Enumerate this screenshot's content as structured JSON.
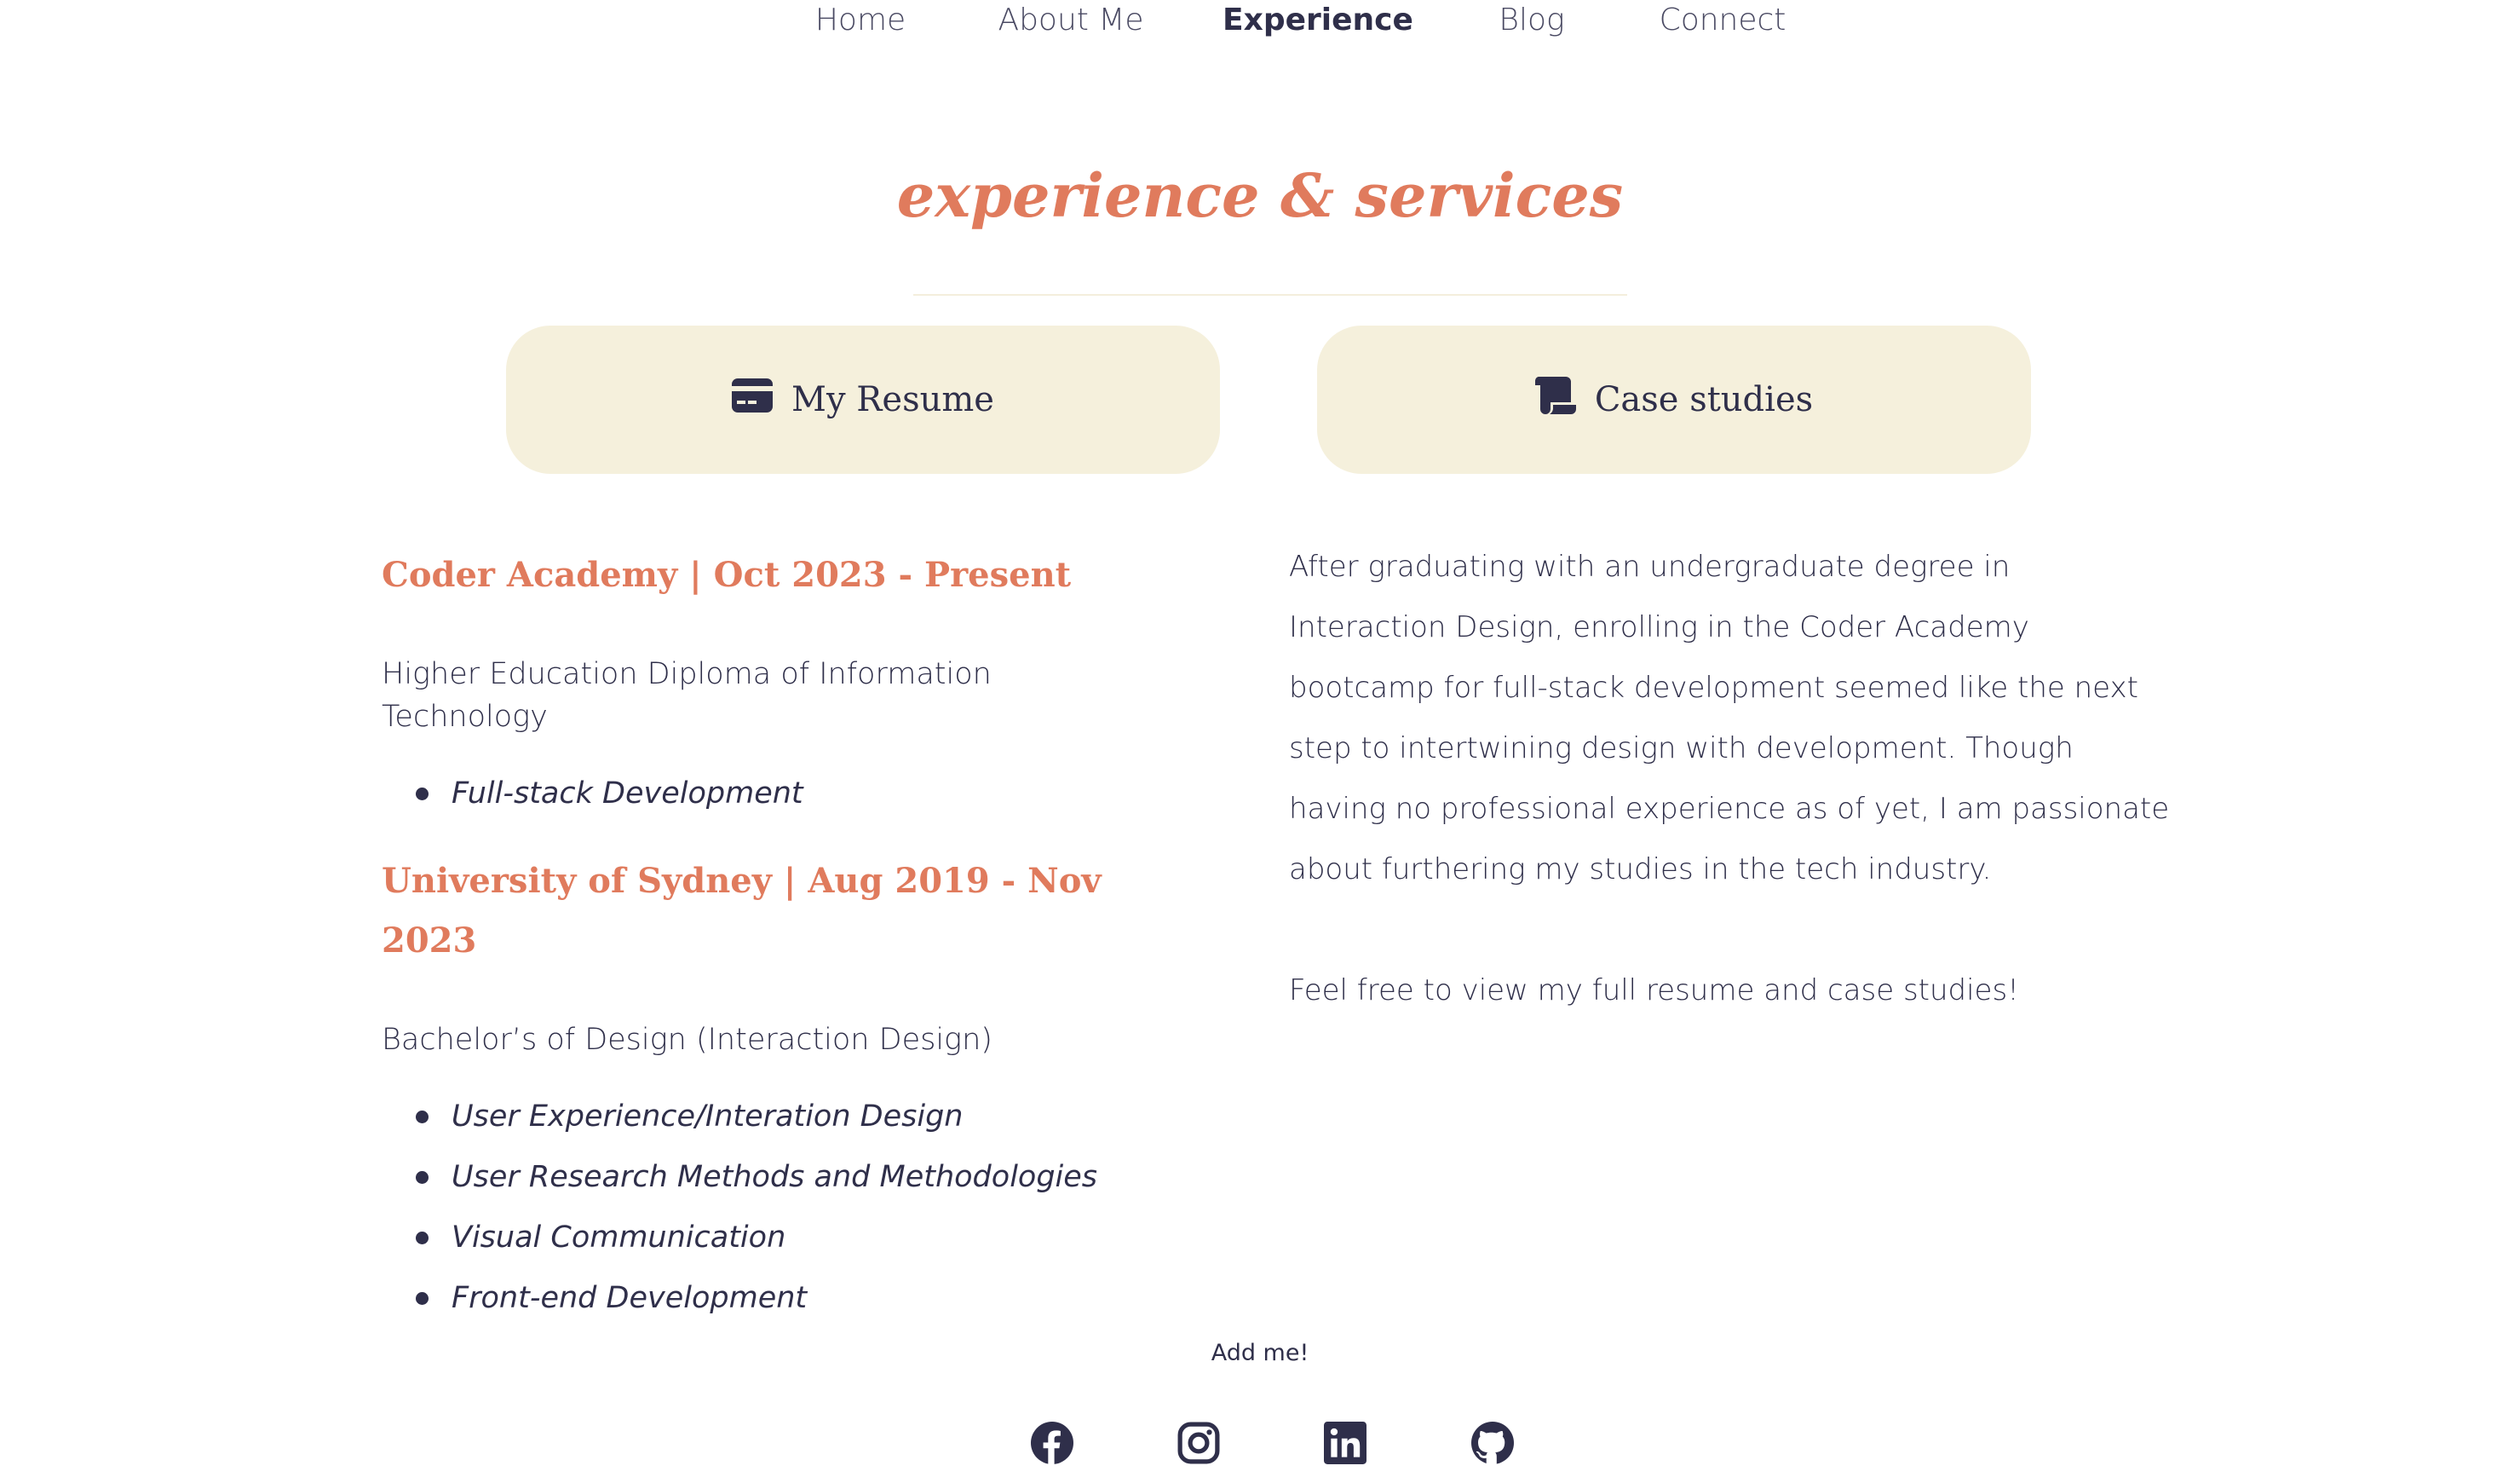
{
  "nav": {
    "items": [
      {
        "label": "Home",
        "active": false
      },
      {
        "label": "About Me",
        "active": false
      },
      {
        "label": "Experience",
        "active": true
      },
      {
        "label": "Blog",
        "active": false
      },
      {
        "label": "Connect",
        "active": false
      }
    ]
  },
  "main": {
    "title": "experience & services",
    "tabs": [
      {
        "label": "My Resume",
        "icon": "credit-card-icon"
      },
      {
        "label": "Case studies",
        "icon": "scroll-icon"
      }
    ]
  },
  "education": [
    {
      "heading": "Coder Academy | Oct 2023 - Present",
      "degree": "Higher Education Diploma of Information Technology",
      "subjects": [
        "Full-stack Development"
      ]
    },
    {
      "heading": "University of Sydney | Aug 2019 - Nov 2023",
      "degree": "Bachelor’s of Design (Interaction Design)",
      "subjects": [
        "User Experience/Interation Design",
        "User Research Methods and Methodologies",
        "Visual Communication",
        "Front-end Development"
      ]
    }
  ],
  "about": {
    "paragraph1": "After graduating with an undergraduate degree in Interaction Design, enrolling in the Coder Academy bootcamp for full-stack development seemed like the next step to intertwining design with development. Though having no professional experience as of yet, I am passionate about furthering my studies in the tech industry.",
    "paragraph2": "Feel free to view my full resume and case studies!"
  },
  "footer": {
    "label": "Add me!",
    "social": [
      {
        "icon": "facebook-icon"
      },
      {
        "icon": "instagram-icon"
      },
      {
        "icon": "linkedin-icon"
      },
      {
        "icon": "github-icon"
      }
    ]
  },
  "colors": {
    "accent": "#e07b5d",
    "text": "#2f2f4a",
    "button_bg": "#f5f0dc"
  }
}
